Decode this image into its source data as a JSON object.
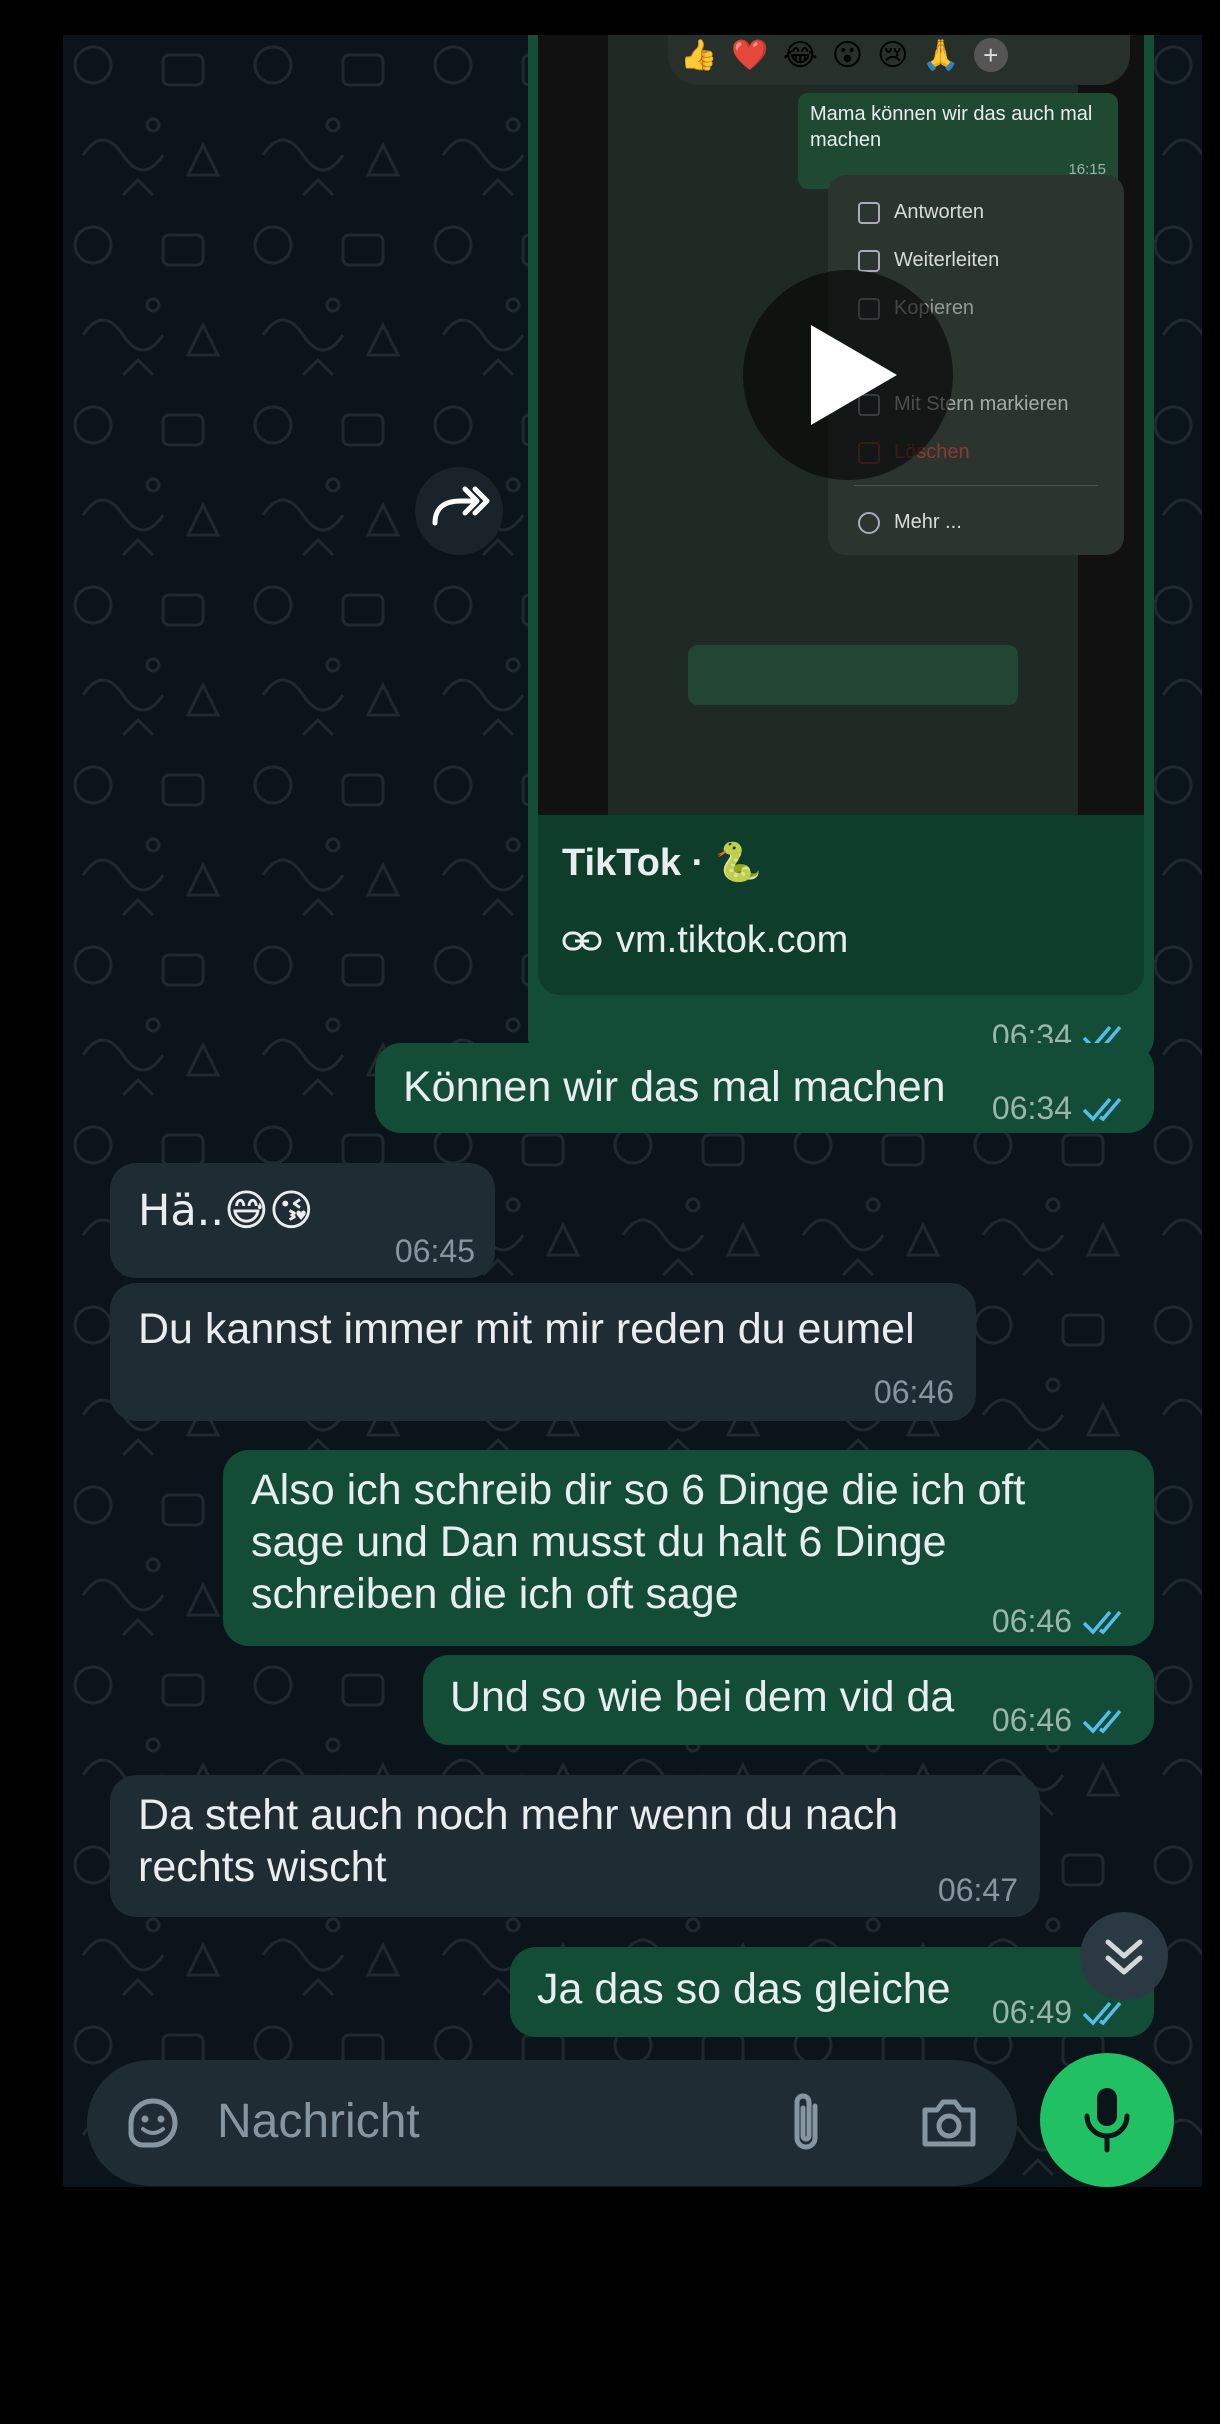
{
  "forwarded_video": {
    "reactions": [
      "👍",
      "❤️",
      "😂",
      "😮",
      "😢",
      "🙏"
    ],
    "inner_message": {
      "text": "Mama können wir das auch mal machen",
      "time": "16:15"
    },
    "context_menu": [
      "Antworten",
      "Weiterleiten",
      "Kopieren",
      "",
      "Mit Stern markieren",
      "Löschen",
      "Mehr ..."
    ],
    "link_title": "TikTok · 🐍",
    "link_url": "vm.tiktok.com",
    "time": "06:34"
  },
  "messages": [
    {
      "id": "m1",
      "direction": "out",
      "text": "Können wir das mal machen",
      "time": "06:34"
    },
    {
      "id": "m2",
      "direction": "in",
      "text": "Hä..😅😘",
      "time": "06:45"
    },
    {
      "id": "m3",
      "direction": "in",
      "text": "Du kannst immer mit mir reden du eumel",
      "time": "06:46"
    },
    {
      "id": "m4",
      "direction": "out",
      "text": "Also ich schreib dir so 6 Dinge die ich oft sage und Dan musst du halt 6 Dinge schreiben die ich oft sage",
      "time": "06:46"
    },
    {
      "id": "m5",
      "direction": "out",
      "text": "Und so wie bei dem vid da",
      "time": "06:46"
    },
    {
      "id": "m6",
      "direction": "in",
      "text": "Da steht auch noch mehr wenn du nach rechts wischt",
      "time": "06:47"
    },
    {
      "id": "m7",
      "direction": "out",
      "text": "Ja das so das gleiche",
      "time": "06:49"
    }
  ],
  "composer": {
    "placeholder": "Nachricht"
  },
  "icons": {
    "sticker": "sticker-icon",
    "attach": "paperclip-icon",
    "camera": "camera-icon",
    "mic": "microphone-icon",
    "forward": "forward-icon",
    "scroll_down": "double-chevron-down-icon",
    "play": "play-icon"
  },
  "colors": {
    "background": "#0b141a",
    "outgoing_bubble": "#144d37",
    "incoming_bubble": "#202c33",
    "read_ticks": "#53bdeb",
    "mic_button": "#21c063"
  }
}
